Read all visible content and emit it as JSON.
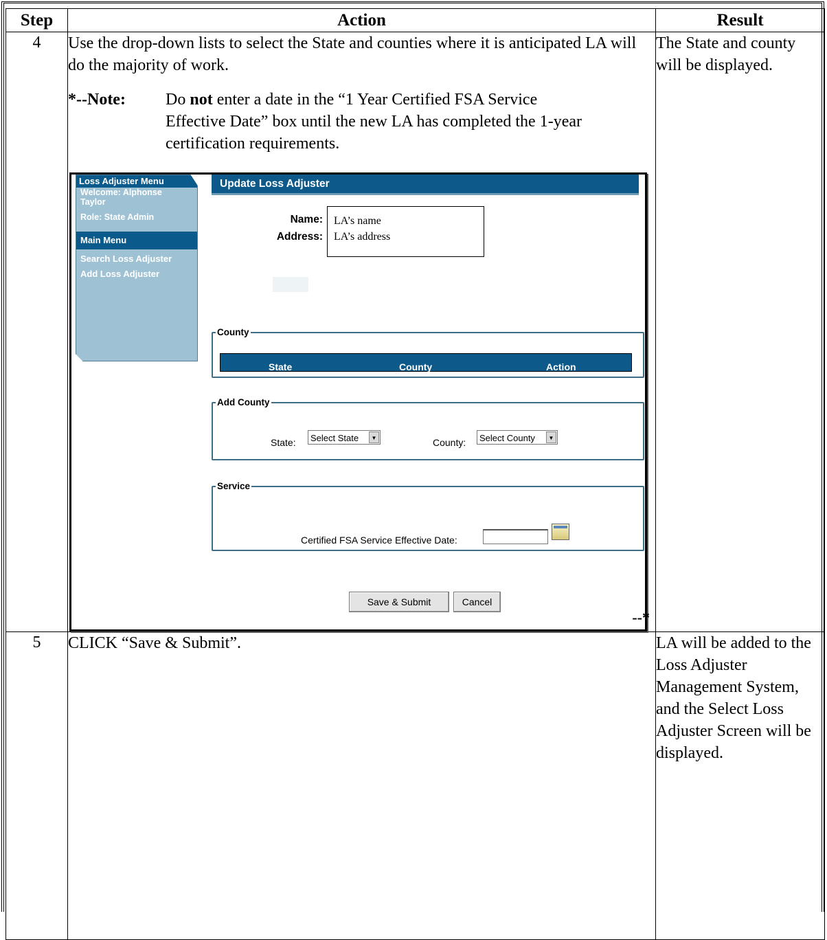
{
  "table": {
    "headers": {
      "step": "Step",
      "action": "Action",
      "result": "Result"
    },
    "rows": [
      {
        "step": "4",
        "action_text": "Use the drop-down lists to select the State and counties where it is anticipated LA will do the majority of work.",
        "note_label": "*--Note:",
        "note_pre": "Do ",
        "note_bold": "not",
        "note_post": " enter a date in the “1 Year Certified FSA Service Effective Date” box until the new LA has completed the 1-year certification requirements.",
        "end_marker": "--*",
        "result": "The State and county will be displayed."
      },
      {
        "step": "5",
        "action_text": "CLICK “Save & Submit”.",
        "result": "LA will be added to the Loss Adjuster Management System, and the Select Loss Adjuster Screen will be displayed."
      }
    ]
  },
  "screen": {
    "sidebar": {
      "title": "Loss Adjuster Menu",
      "welcome": "Welcome: Alphonse Taylor",
      "role": "Role: State Admin",
      "menu_header": "Main Menu",
      "links": [
        "Search Loss Adjuster",
        "Add Loss Adjuster"
      ]
    },
    "header": "Update Loss Adjuster",
    "name_label": "Name:",
    "address_label": "Address:",
    "name_value": "LA’s name",
    "address_value": "LA’s address",
    "county_legend": "County",
    "county_columns": [
      "State",
      "County",
      "Action"
    ],
    "add_county_legend": "Add County",
    "state_label": "State:",
    "state_select": "Select State",
    "county_label": "County:",
    "county_select": "Select County",
    "service_legend": "Service",
    "service_label": "Certified FSA Service Effective Date:",
    "save_button": "Save & Submit",
    "cancel_button": "Cancel"
  }
}
